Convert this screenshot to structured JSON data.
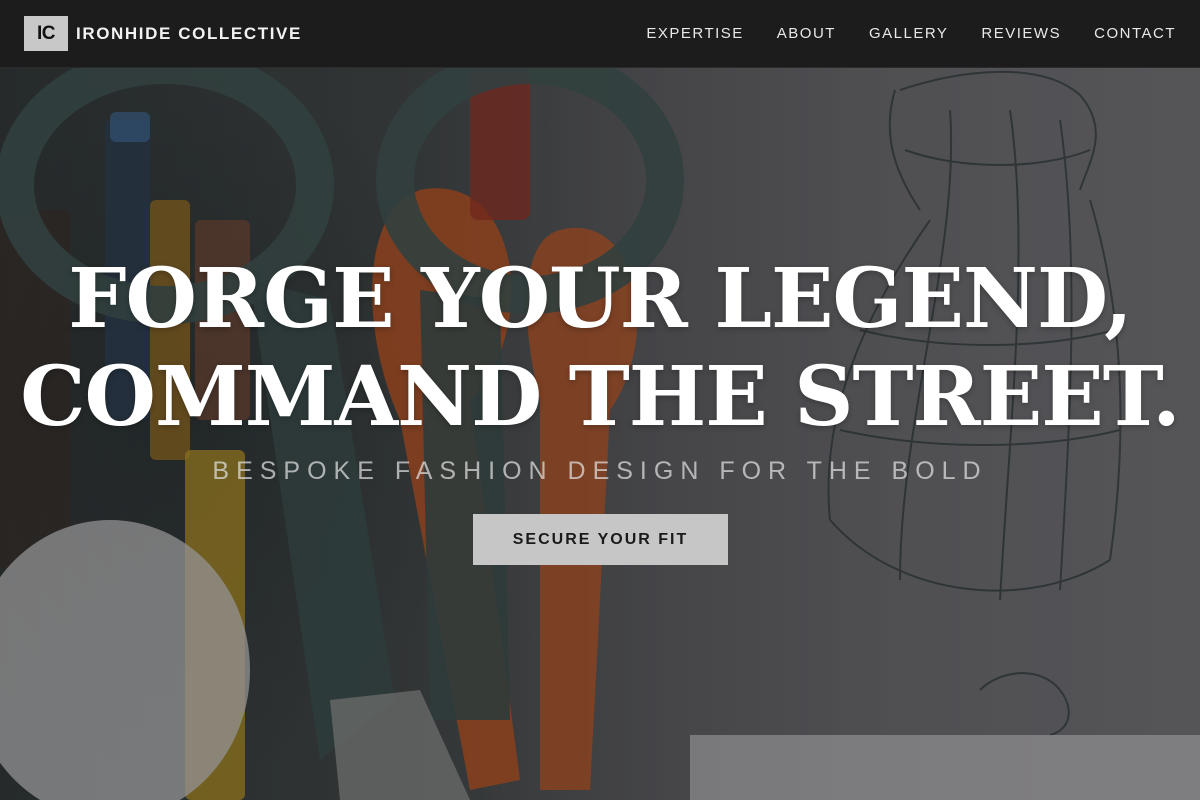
{
  "brand": {
    "logo_text": "IC",
    "name": "IRONHIDE COLLECTIVE"
  },
  "nav": {
    "items": [
      {
        "label": "EXPERTISE"
      },
      {
        "label": "ABOUT"
      },
      {
        "label": "GALLERY"
      },
      {
        "label": "REVIEWS"
      },
      {
        "label": "CONTACT"
      }
    ]
  },
  "hero": {
    "headline_line1": "FORGE YOUR LEGEND,",
    "headline_line2": "COMMAND THE STREET.",
    "subtitle": "BESPOKE FASHION DESIGN FOR THE BOLD",
    "cta_label": "SECURE YOUR FIT"
  },
  "colors": {
    "navbar_bg": "#1c1c1c",
    "logo_bg": "#c8c8c8",
    "cta_bg": "#c6c6c6",
    "headline_text": "#ffffff"
  }
}
